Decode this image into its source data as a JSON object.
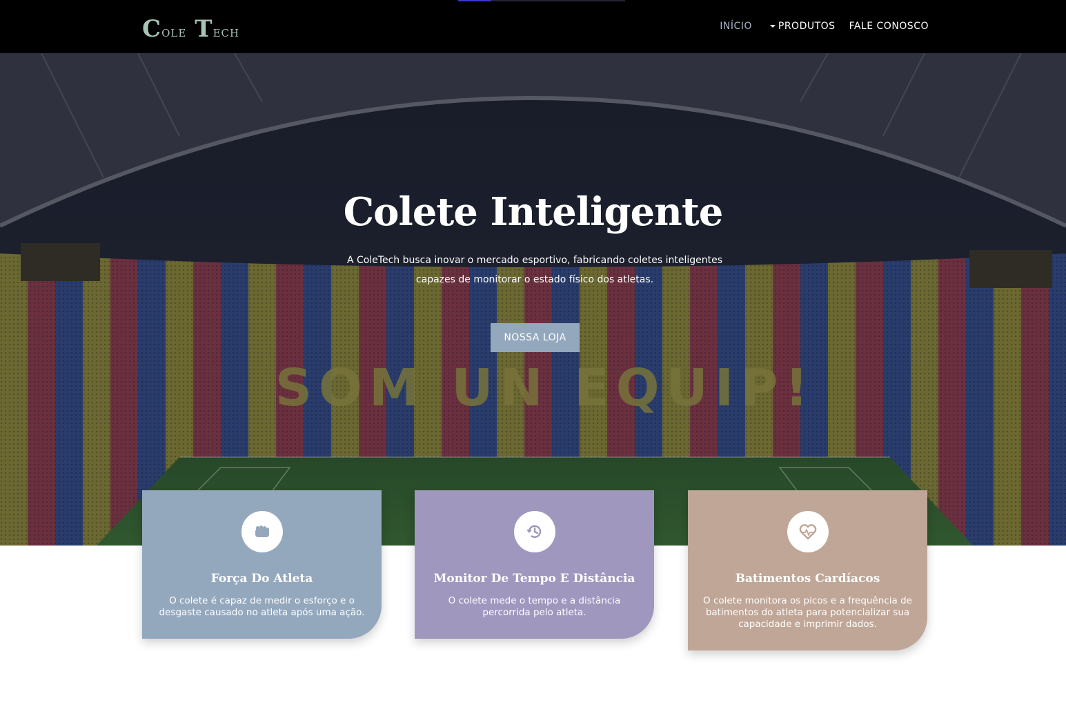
{
  "brand": {
    "c1": "C",
    "r1": "ole",
    "c2": "T",
    "r2": "ech"
  },
  "nav": {
    "progress_fraction": 0.2,
    "items": [
      {
        "label": "INÍCIO",
        "active": true
      },
      {
        "label": "PRODUTOS",
        "dropdown": true
      },
      {
        "label": "FALE CONOSCO"
      }
    ]
  },
  "hero": {
    "title": "Colete Inteligente",
    "line1": "A ColeTech busca inovar o mercado esportivo, fabricando coletes inteligentes",
    "line2": "capazes de monitorar o estado físico dos atletas.",
    "button": "NOSSA LOJA",
    "banner": "SOM UN EQUIP!"
  },
  "cards": [
    {
      "title": "Força Do Atleta",
      "text": "O colete é capaz de medir o esforço e o desgaste causado no atleta após uma ação.",
      "icon": "fist-icon",
      "color": "#94a8bd"
    },
    {
      "title": "Monitor De Tempo E Distância",
      "text": "O colete mede o tempo e a distância percorrida pelo atleta.",
      "icon": "history-icon",
      "color": "#a097bf"
    },
    {
      "title": "Batimentos Cardíacos",
      "text": "O colete monitora os picos e a frequência de batimentos do atleta para potencializar sua capacidade e imprimir dados.",
      "icon": "heartbeat-icon",
      "color": "#bfa697"
    }
  ],
  "colors": {
    "nav_bg": "#000000",
    "brand": "#a7c4b5",
    "active_nav": "#a7b6c9",
    "button": "#94a8bd"
  }
}
